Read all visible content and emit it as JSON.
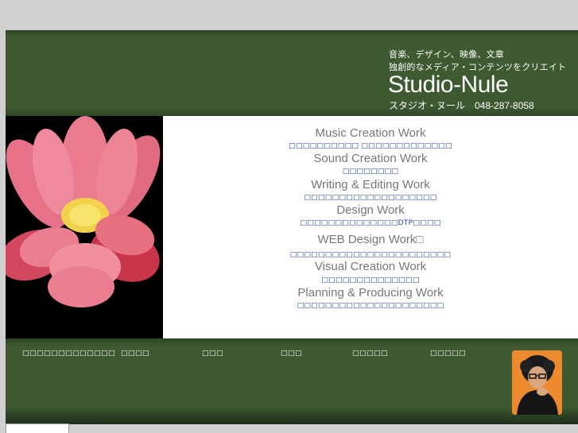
{
  "header": {
    "tagline_1": "音楽、デザイン、映像、文章",
    "tagline_2": "独創的なメディア・コンテンツをクリエイト",
    "brand": "Studio-Nule",
    "contact": "スタジオ・ヌール　048-287-8058"
  },
  "works": [
    {
      "title": "Music Creation Work",
      "desc": "□□□□□□□□□□ □□□□□□□□□□□□□"
    },
    {
      "title": "Sound Creation Work",
      "desc": "□□□□□□□□"
    },
    {
      "title": "Writing & Editing Work",
      "desc": "□□□□□□□□□□□□□□□□□□□"
    },
    {
      "title": "Design Work",
      "desc": "□□□□□□□□□□□□□□DTP□□□□"
    },
    {
      "title": "WEB Design Work□",
      "desc": "□□□□□□□□□□□□□□□□□□□□□□□"
    },
    {
      "title": "Visual Creation Work",
      "desc": "□□□□□□□□□□□□□□"
    },
    {
      "title": "Planning & Producing Work",
      "desc": "□□□□□□□□□□□□□□□□□□□□□"
    }
  ],
  "nav": [
    "□□□□□□□□□□□□□",
    "□□□□",
    "□□□",
    "□□□",
    "□□□□□",
    "□□□□□"
  ],
  "colors": {
    "header_green": "#3d5a31",
    "link_blue": "#1b3fa6",
    "title_gray": "#777777",
    "avatar_orange": "#f39a3a"
  },
  "icons": [
    "lotus-flower-image",
    "profile-photo"
  ]
}
